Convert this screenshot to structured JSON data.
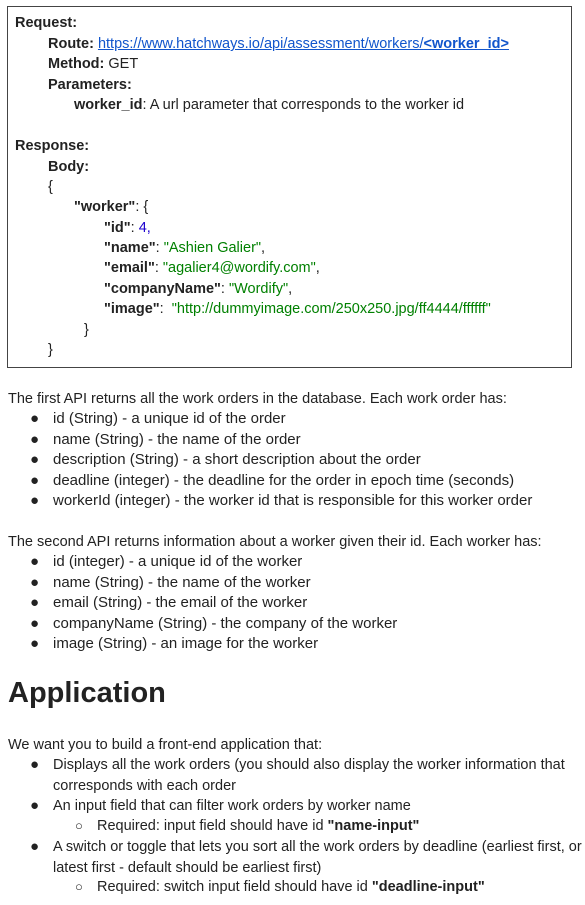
{
  "request_box": {
    "request_label": "Request:",
    "route_label": "Route:",
    "route_url_prefix": "https://www.hatchways.io/api/assessment/workers/",
    "route_url_param": "<worker_id>",
    "method_label": "Method:",
    "method_value": "GET",
    "parameters_label": "Parameters:",
    "param_name": "worker_id",
    "param_desc": ": A url parameter that corresponds to the worker id",
    "response_label": "Response:",
    "body_label": "Body:",
    "open_brace": "{",
    "worker_key": "\"worker\"",
    "worker_open": ": {",
    "fields": [
      {
        "key": "\"id\"",
        "sep": ": ",
        "value": "4,",
        "kind": "num",
        "trail": ""
      },
      {
        "key": "\"name\"",
        "sep": ": ",
        "value": "\"Ashien Galier\"",
        "kind": "str",
        "trail": ","
      },
      {
        "key": "\"email\"",
        "sep": ": ",
        "value": "\"agalier4@wordify.com\"",
        "kind": "str",
        "trail": ","
      },
      {
        "key": "\"companyName\"",
        "sep": ": ",
        "value": "\"Wordify\"",
        "kind": "str",
        "trail": ","
      },
      {
        "key": "\"image\"",
        "sep": ":  ",
        "value": "\"http://dummyimage.com/250x250.jpg/ff4444/ffffff\"",
        "kind": "str",
        "trail": ""
      }
    ],
    "inner_close": "}",
    "outer_close": "}"
  },
  "first_api": {
    "intro": "The first API returns all the work orders in the database. Each work order has:",
    "items": [
      "id (String) - a unique id of the order",
      "name (String) - the name of the order",
      "description (String) - a short description about the order",
      "deadline (integer) - the deadline for the order in epoch time (seconds)",
      "workerId (integer) - the worker id that is responsible for this worker order"
    ]
  },
  "second_api": {
    "intro": "The second API returns information about a worker given their id. Each worker has:",
    "items": [
      "id (integer) - a unique id of the worker",
      "name (String) - the name of the worker",
      "email (String) - the email of the worker",
      "companyName (String) - the company of the worker",
      "image (String) - an image for the worker"
    ]
  },
  "application": {
    "heading": "Application",
    "intro": "We want you to build a front-end application that:",
    "item1": "Displays all the work orders (you should also display the worker information that corresponds with each order",
    "item2": "An input field that can filter work orders by worker name",
    "item2_sub_prefix": "Required: input field should have id ",
    "item2_sub_id": "\"name-input\"",
    "item3": "A switch or toggle that lets you sort all the work orders by deadline (earliest first, or latest first - default should be earliest first)",
    "item3_sub_prefix": "Required: switch input field should have id ",
    "item3_sub_id": "\"deadline-input\""
  },
  "glyphs": {
    "bullet": "●",
    "sub_bullet": "○"
  }
}
